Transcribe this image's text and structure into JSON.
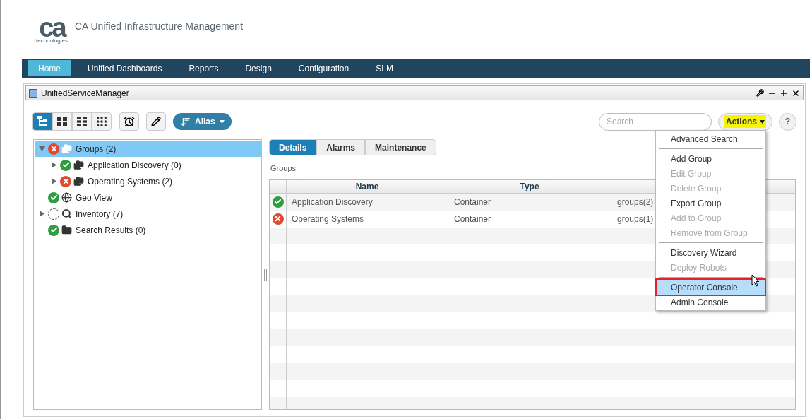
{
  "header": {
    "logo_mark": "ca",
    "logo_sub": "technologies",
    "title": "CA Unified Infrastructure Management"
  },
  "nav": [
    {
      "label": "Home",
      "selected": true
    },
    {
      "label": "Unified Dashboards",
      "selected": false
    },
    {
      "label": "Reports",
      "selected": false
    },
    {
      "label": "Design",
      "selected": false
    },
    {
      "label": "Configuration",
      "selected": false
    },
    {
      "label": "SLM",
      "selected": false
    }
  ],
  "portlet": {
    "title": "UnifiedServiceManager"
  },
  "toolbar": {
    "views": [
      {
        "kind": "tree",
        "selected": true
      },
      {
        "kind": "grid4",
        "selected": false
      },
      {
        "kind": "grid6",
        "selected": false
      },
      {
        "kind": "grid9",
        "selected": false
      }
    ],
    "sort_label": "Alias",
    "search": {
      "placeholder": "Search"
    },
    "actions_label": "Actions",
    "help": "?"
  },
  "tree": [
    {
      "label": "Groups (2)",
      "kind": "error",
      "expanded": true,
      "selected": true,
      "children": [
        {
          "label": "Application Discovery (0)",
          "kind": "ok",
          "expanded": false,
          "selected": false
        },
        {
          "label": "Operating Systems (2)",
          "kind": "error",
          "expanded": false,
          "selected": false
        }
      ]
    },
    {
      "label": "Geo View",
      "kind": "ok",
      "selected": false
    },
    {
      "label": "Inventory (7)",
      "kind": "none",
      "expanded": false,
      "selected": false
    },
    {
      "label": "Search Results (0)",
      "kind": "ok",
      "selected": false
    }
  ],
  "tabs": [
    {
      "label": "Details",
      "selected": true
    },
    {
      "label": "Alarms",
      "selected": false
    },
    {
      "label": "Maintenance",
      "selected": false
    }
  ],
  "caption": "Groups",
  "table": {
    "columns": [
      "Name",
      "Type"
    ],
    "rows": [
      {
        "kind": "ok",
        "name": "Application Discovery",
        "type": "Container",
        "column_3": "groups(2)"
      },
      {
        "kind": "error",
        "name": "Operating Systems",
        "type": "Container",
        "column_3": "groups(1)"
      }
    ]
  },
  "menu": [
    {
      "kind": "item",
      "label": "Advanced Search",
      "disabled": false,
      "selected": false
    },
    {
      "kind": "separator"
    },
    {
      "kind": "item",
      "label": "Add Group",
      "disabled": false,
      "selected": false
    },
    {
      "kind": "item",
      "label": "Edit Group",
      "disabled": true,
      "selected": false
    },
    {
      "kind": "item",
      "label": "Delete Group",
      "disabled": true,
      "selected": false
    },
    {
      "kind": "item",
      "label": "Export Group",
      "disabled": false,
      "selected": false
    },
    {
      "kind": "item",
      "label": "Add to Group",
      "disabled": true,
      "selected": false
    },
    {
      "kind": "item",
      "label": "Remove from Group",
      "disabled": true,
      "selected": false
    },
    {
      "kind": "separator"
    },
    {
      "kind": "item",
      "label": "Discovery Wizard",
      "disabled": false,
      "selected": false
    },
    {
      "kind": "item",
      "label": "Deploy Robots",
      "disabled": true,
      "selected": false
    },
    {
      "kind": "separator"
    },
    {
      "kind": "item",
      "label": "Operator Console",
      "disabled": false,
      "selected": true
    },
    {
      "kind": "item",
      "label": "Admin Console",
      "disabled": false,
      "selected": false
    }
  ]
}
